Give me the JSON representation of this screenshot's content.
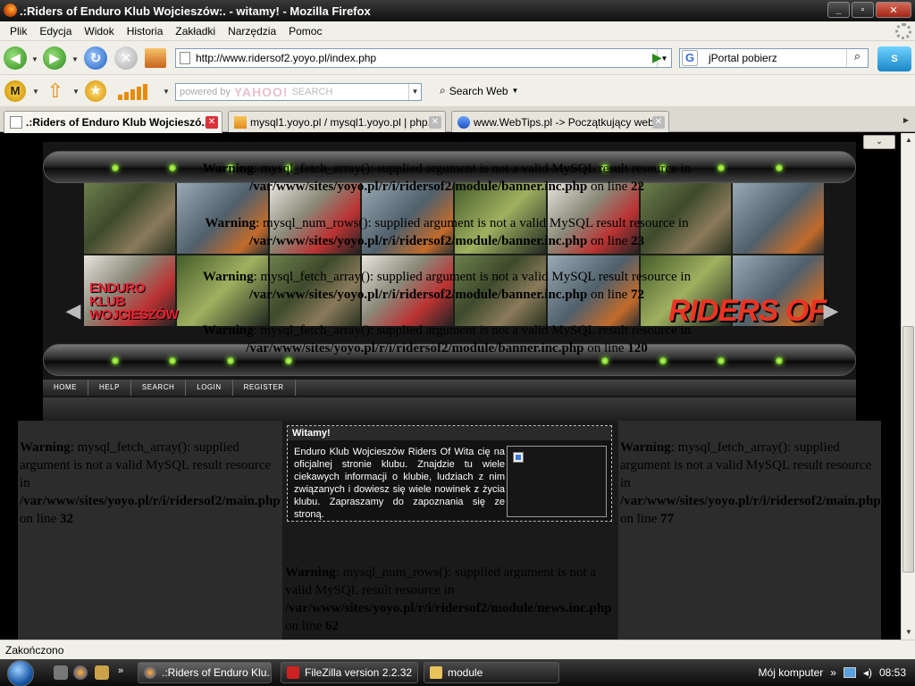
{
  "window": {
    "title": ".:Riders of Enduro Klub Wojcieszów:. - witamy! - Mozilla Firefox"
  },
  "menu": [
    "Plik",
    "Edycja",
    "Widok",
    "Historia",
    "Zakładki",
    "Narzędzia",
    "Pomoc"
  ],
  "nav": {
    "url": "http://www.ridersof2.yoyo.pl/index.php",
    "search_value": "jPortal pobierz"
  },
  "yahoo": {
    "placeholder_powered": "powered by",
    "yahoo_label": "YAHOO!",
    "search_label": "SEARCH",
    "search_web": "Search Web"
  },
  "tabs": [
    {
      "label": ".:Riders of Enduro Klub Wojcieszó...",
      "active": true
    },
    {
      "label": "mysql1.yoyo.pl / mysql1.yoyo.pl | php...",
      "active": false
    },
    {
      "label": "www.WebTips.pl -> Początkujący web...",
      "active": false
    }
  ],
  "site": {
    "navlinks": [
      "HOME",
      "HELP",
      "SEARCH",
      "LOGIN",
      "REGISTER"
    ],
    "banner_klub": [
      "ENDURO",
      "KLUB",
      "WOJCIESZÓW"
    ],
    "banner_riders": "RIDERS OF",
    "banner_warnings": [
      {
        "warn": "Warning",
        "msg": ": mysql_fetch_array(): supplied argument is not a valid MySQL result resource in",
        "path": "/var/www/sites/yoyo.pl/r/i/ridersof2/module/banner.inc.php",
        "on_line": "on line",
        "line": "22"
      },
      {
        "warn": "Warning",
        "msg": ": mysql_num_rows(): supplied argument is not a valid MySQL result resource in",
        "path": "/var/www/sites/yoyo.pl/r/i/ridersof2/module/banner.inc.php",
        "on_line": "on line",
        "line": "23"
      },
      {
        "warn": "Warning",
        "msg": ": mysql_fetch_array(): supplied argument is not a valid MySQL result resource in",
        "path": "/var/www/sites/yoyo.pl/r/i/ridersof2/module/banner.inc.php",
        "on_line": "on line",
        "line": "72"
      },
      {
        "warn": "Warning",
        "msg": ": mysql_fetch_array(): supplied argument is not a valid MySQL result resource in",
        "path": "/var/www/sites/yoyo.pl/r/i/ridersof2/module/banner.inc.php",
        "on_line": "on line",
        "line": "120"
      }
    ],
    "left_warning": {
      "warn": "Warning",
      "msg": ": mysql_fetch_array(): supplied argument is not a valid MySQL result resource in",
      "path": "/var/www/sites/yoyo.pl/r/i/ridersof2/main.php",
      "on_line": "on line",
      "line": "32"
    },
    "right_warning": {
      "warn": "Warning",
      "msg": ": mysql_fetch_array(): supplied argument is not a valid MySQL result resource in",
      "path": "/var/www/sites/yoyo.pl/r/i/ridersof2/main.php",
      "on_line": "on line",
      "line": "77"
    },
    "news_warning": {
      "warn": "Warning",
      "msg": ": mysql_num_rows(): supplied argument is not a valid MySQL result resource in",
      "path": "/var/www/sites/yoyo.pl/r/i/ridersof2/module/news.inc.php",
      "on_line": "on line",
      "line": "62"
    },
    "welcome": {
      "title": "Witamy!",
      "text": "Enduro Klub Wojcieszów Riders Of Wita cię na oficjalnej stronie klubu. Znajdzie tu wiele ciekawych informacji o klubie, ludziach z nim związanych i dowiesz się wiele nowinek z życia klubu. Zapraszamy do zapoznania się ze stroną."
    }
  },
  "status": {
    "text": "Zakończono"
  },
  "taskbar": {
    "tasks": [
      ".:Riders of Enduro Klu...",
      "FileZilla version 2.2.32",
      "module"
    ],
    "my_computer": "Mój komputer",
    "clock": "08:53"
  }
}
